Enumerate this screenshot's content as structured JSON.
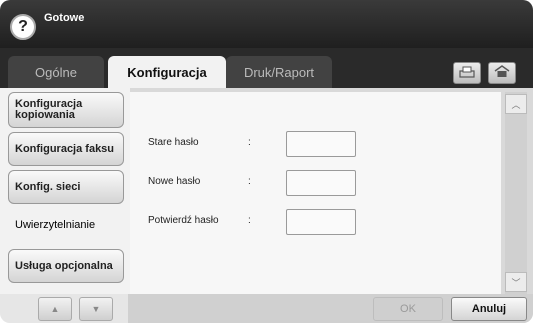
{
  "header": {
    "status": "Gotowe",
    "help_icon": "?"
  },
  "tabs": [
    {
      "label": "Ogólne",
      "active": false
    },
    {
      "label": "Konfiguracja",
      "active": true
    },
    {
      "label": "Druk/Raport",
      "active": false
    }
  ],
  "toolbar": {
    "icons": [
      "job-status-icon",
      "home-icon"
    ]
  },
  "sidebar": {
    "items": [
      {
        "label": "Konfiguracja kopiowania",
        "selected": false
      },
      {
        "label": "Konfiguracja faksu",
        "selected": false
      },
      {
        "label": "Konfig. sieci",
        "selected": false
      },
      {
        "label": "Uwierzytelnianie",
        "selected": true
      },
      {
        "label": "Usługa opcjonalna",
        "selected": false
      }
    ],
    "nav_up": "▲",
    "nav_down": "▼"
  },
  "form": {
    "fields": [
      {
        "label": "Stare hasło",
        "colon": ":",
        "value": ""
      },
      {
        "label": "Nowe hasło",
        "colon": ":",
        "value": ""
      },
      {
        "label": "Potwierdź hasło",
        "colon": ":",
        "value": ""
      }
    ]
  },
  "scroll": {
    "up": "︿",
    "down": "﹀"
  },
  "buttons": {
    "ok": "OK",
    "cancel": "Anuluj"
  },
  "colors": {
    "title_bar": "#2a2a2a",
    "content_bg": "#f7f7f7",
    "accent": "#1f1f1f"
  }
}
